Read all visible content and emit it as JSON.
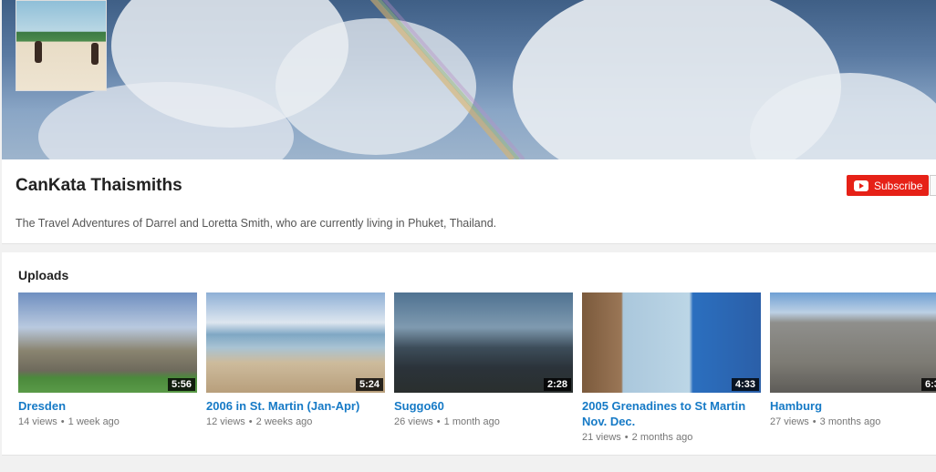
{
  "channel": {
    "name": "CanKata Thaismiths",
    "description": "The Travel Adventures of Darrel and Loretta Smith, who are currently living in Phuket, Thailand.",
    "subscribe_label": "Subscribe"
  },
  "uploads": {
    "title": "Uploads",
    "videos": [
      {
        "title": "Dresden",
        "views": "14 views",
        "age": "1 week ago",
        "duration": "5:56"
      },
      {
        "title": "2006 in St. Martin (Jan-Apr)",
        "views": "12 views",
        "age": "2 weeks ago",
        "duration": "5:24"
      },
      {
        "title": "Suggo60",
        "views": "26 views",
        "age": "1 month ago",
        "duration": "2:28"
      },
      {
        "title": "2005 Grenadines to St Martin Nov. Dec.",
        "views": "21 views",
        "age": "2 months ago",
        "duration": "4:33"
      },
      {
        "title": "Hamburg",
        "views": "27 views",
        "age": "3 months ago",
        "duration": "6:3"
      }
    ]
  },
  "icons": {
    "subscribe": "youtube-play-icon"
  }
}
